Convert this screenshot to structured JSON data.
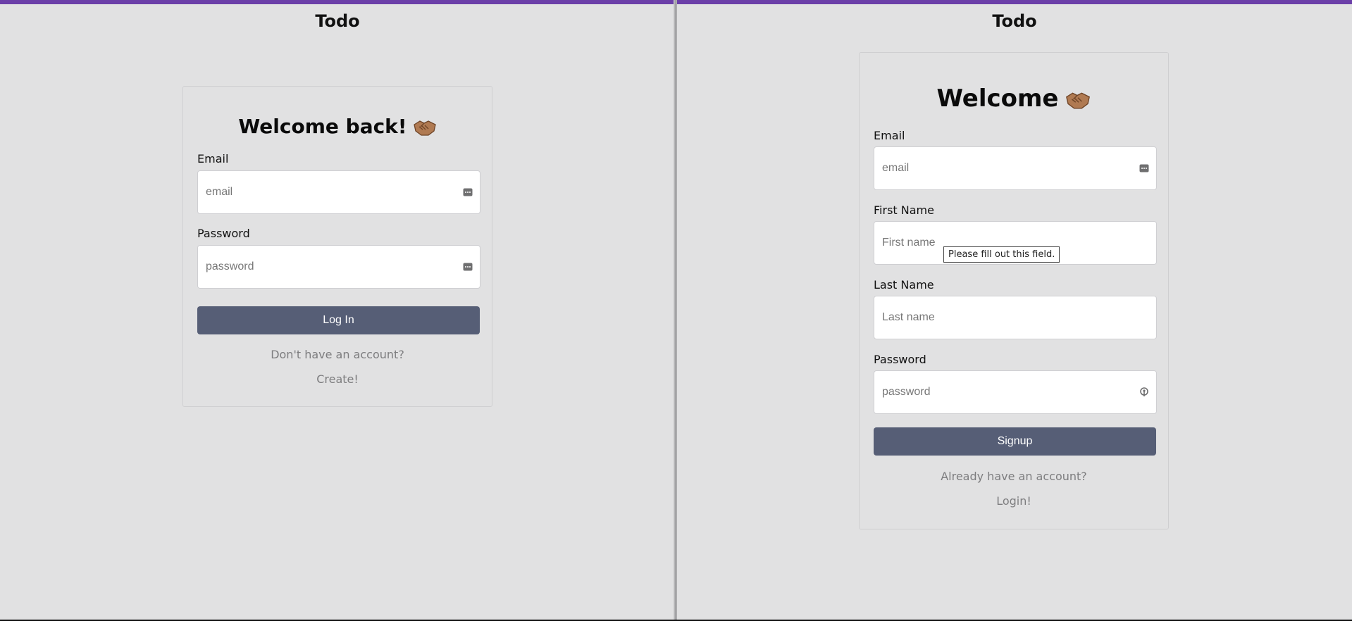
{
  "app": {
    "accent_color": "#6b3fa8",
    "background_color": "#e1e1e2",
    "button_color": "#565e76"
  },
  "login": {
    "app_title": "Todo",
    "heading": "Welcome back!",
    "emoji_icon": "handshake-icon",
    "email_label": "Email",
    "email_placeholder": "email",
    "email_icon": "password-manager-icon",
    "password_label": "Password",
    "password_placeholder": "password",
    "password_icon": "password-manager-icon",
    "submit_label": "Log In",
    "prompt_text": "Don't have an account?",
    "link_text": "Create!"
  },
  "signup": {
    "app_title": "Todo",
    "heading": "Welcome",
    "emoji_icon": "handshake-icon",
    "email_label": "Email",
    "email_placeholder": "email",
    "email_icon": "password-manager-icon",
    "first_name_label": "First Name",
    "first_name_placeholder": "First name",
    "last_name_label": "Last Name",
    "last_name_placeholder": "Last name",
    "password_label": "Password",
    "password_placeholder": "password",
    "password_icon": "key-icon",
    "submit_label": "Signup",
    "prompt_text": "Already have an account?",
    "link_text": "Login!",
    "validation_tooltip": "Please fill out this field."
  }
}
